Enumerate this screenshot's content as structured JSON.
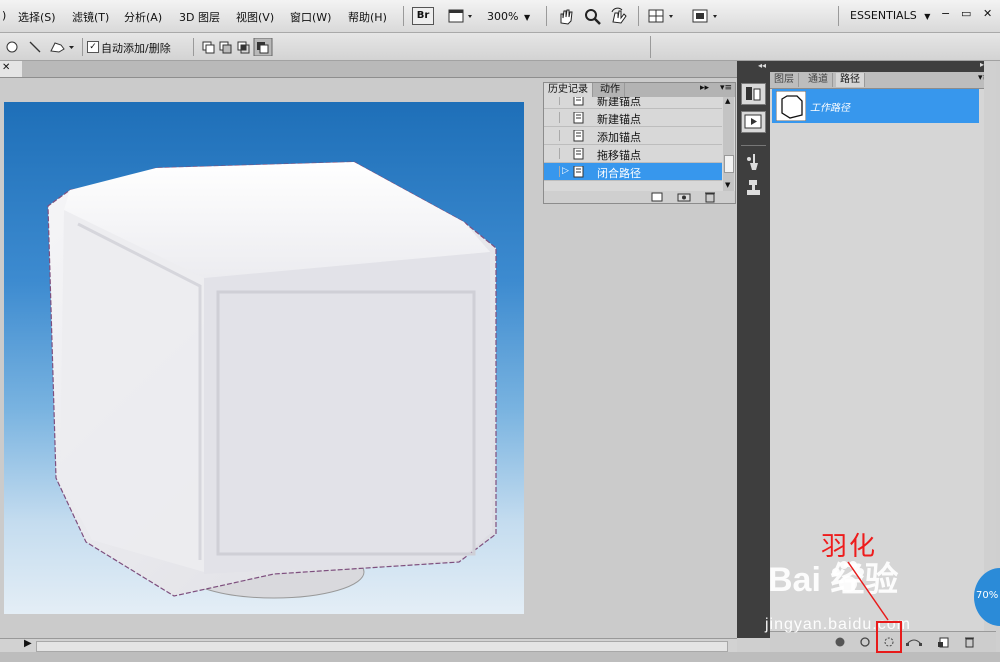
{
  "menubar": {
    "partial_item": ")",
    "items": [
      "选择(S)",
      "滤镜(T)",
      "分析(A)",
      "3D 图层",
      "视图(V)",
      "窗口(W)",
      "帮助(H)"
    ],
    "bridge_label": "Br",
    "zoom_value": "300%",
    "workspace": "ESSENTIALS",
    "workspace_arrow": "▼",
    "win_min": "−",
    "win_restore": "▭",
    "win_close": "✕"
  },
  "options": {
    "auto_add_delete_label": "自动添加/删除",
    "auto_add_delete_checked": true
  },
  "history_panel": {
    "tabs": [
      "历史记录",
      "动作"
    ],
    "rows": [
      "新建锚点",
      "新建锚点",
      "添加锚点",
      "拖移锚点",
      "闭合路径"
    ],
    "selected_index": 4
  },
  "paths_panel": {
    "tabs": [
      "图层",
      "通道",
      "路径"
    ],
    "active_tab": "路径",
    "work_path_label": "工作路径"
  },
  "annotation": {
    "label": "羽化",
    "color": "#ee1c1c"
  },
  "watermark": {
    "brand": "Bai  经验",
    "url": "jingyan.baidu.com"
  },
  "zoom_badge": "70%",
  "colors": {
    "selection_blue": "#3797ed",
    "dock_dark": "#3e3e3e"
  }
}
